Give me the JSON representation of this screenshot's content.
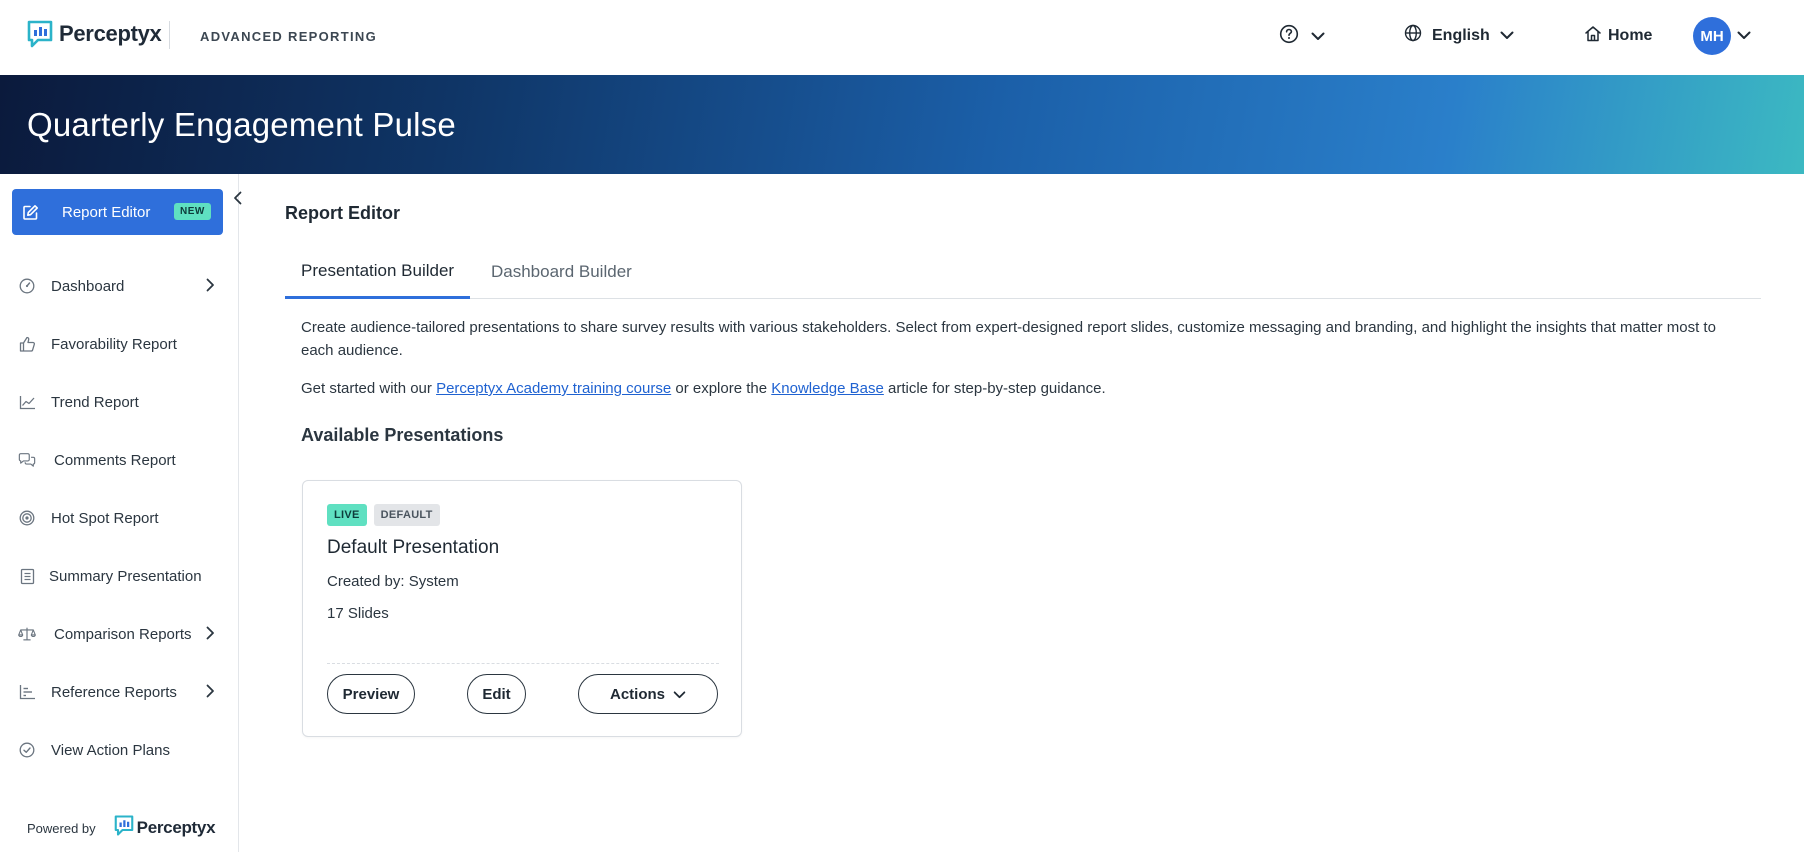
{
  "header": {
    "brand_name": "Perceptyx",
    "product_name": "ADVANCED REPORTING",
    "help_icon": "help-circle-icon",
    "language_label": "English",
    "home_label": "Home",
    "user_initials": "MH"
  },
  "banner": {
    "title": "Quarterly Engagement Pulse"
  },
  "sidebar": {
    "active_item": {
      "label": "Report Editor",
      "badge": "NEW",
      "icon": "edit-icon"
    },
    "items": [
      {
        "label": "Dashboard",
        "icon": "gauge-icon",
        "has_submenu": true
      },
      {
        "label": "Favorability Report",
        "icon": "thumbs-up-icon",
        "has_submenu": false
      },
      {
        "label": "Trend Report",
        "icon": "line-chart-icon",
        "has_submenu": false
      },
      {
        "label": "Comments Report",
        "icon": "chat-bubbles-icon",
        "has_submenu": false
      },
      {
        "label": "Hot Spot Report",
        "icon": "target-icon",
        "has_submenu": false
      },
      {
        "label": "Summary Presentation",
        "icon": "document-list-icon",
        "has_submenu": false
      },
      {
        "label": "Comparison Reports",
        "icon": "balance-scale-icon",
        "has_submenu": true
      },
      {
        "label": "Reference Reports",
        "icon": "bar-chart-icon",
        "has_submenu": true
      },
      {
        "label": "View Action Plans",
        "icon": "check-circle-icon",
        "has_submenu": false
      }
    ],
    "powered_by_label": "Powered by",
    "powered_by_brand": "Perceptyx"
  },
  "main": {
    "heading": "Report Editor",
    "tabs": [
      {
        "label": "Presentation Builder",
        "active": true
      },
      {
        "label": "Dashboard Builder",
        "active": false
      }
    ],
    "description": "Create audience-tailored presentations to share survey results with various stakeholders. Select from expert-designed report slides, customize messaging and branding, and highlight the insights that matter most to each audience.",
    "guidance": {
      "prefix": "Get started with our ",
      "link1": "Perceptyx Academy training course",
      "middle": " or explore the ",
      "link2": "Knowledge Base",
      "suffix": " article for step-by-step guidance."
    },
    "section_title": "Available Presentations",
    "presentations": [
      {
        "badges": [
          "LIVE",
          "DEFAULT"
        ],
        "title": "Default Presentation",
        "created_by": "Created by: System",
        "slides": "17 Slides",
        "preview_label": "Preview",
        "edit_label": "Edit",
        "actions_label": "Actions"
      }
    ]
  },
  "colors": {
    "accent": "#2f6fdb",
    "badge_teal": "#5fe0c1",
    "link": "#1f62d1"
  }
}
